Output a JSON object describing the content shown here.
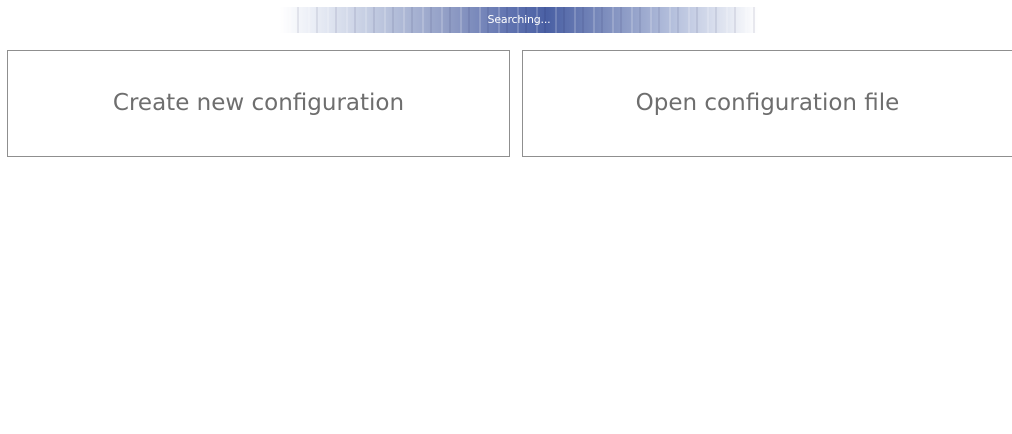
{
  "status": {
    "text": "Searching..."
  },
  "actions": {
    "create_label": "Create new configuration",
    "open_label": "Open configuration file"
  }
}
